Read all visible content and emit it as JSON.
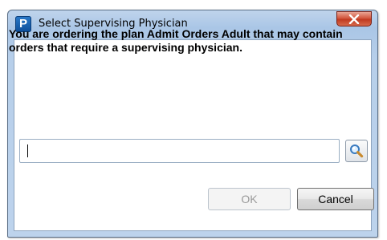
{
  "window": {
    "app_icon_letter": "P",
    "title": "Select Supervising Physician",
    "close_icon": "close-x-icon"
  },
  "message": "You are ordering the plan Admit Orders Adult that may contain orders that require a supervising physician.",
  "search": {
    "value": "",
    "placeholder": "",
    "button_icon": "magnifier-icon"
  },
  "buttons": {
    "ok_label": "OK",
    "ok_enabled": false,
    "cancel_label": "Cancel"
  },
  "colors": {
    "title_bar": "#aac6e6",
    "close_button": "#c8452b",
    "app_icon": "#1a64b4"
  }
}
